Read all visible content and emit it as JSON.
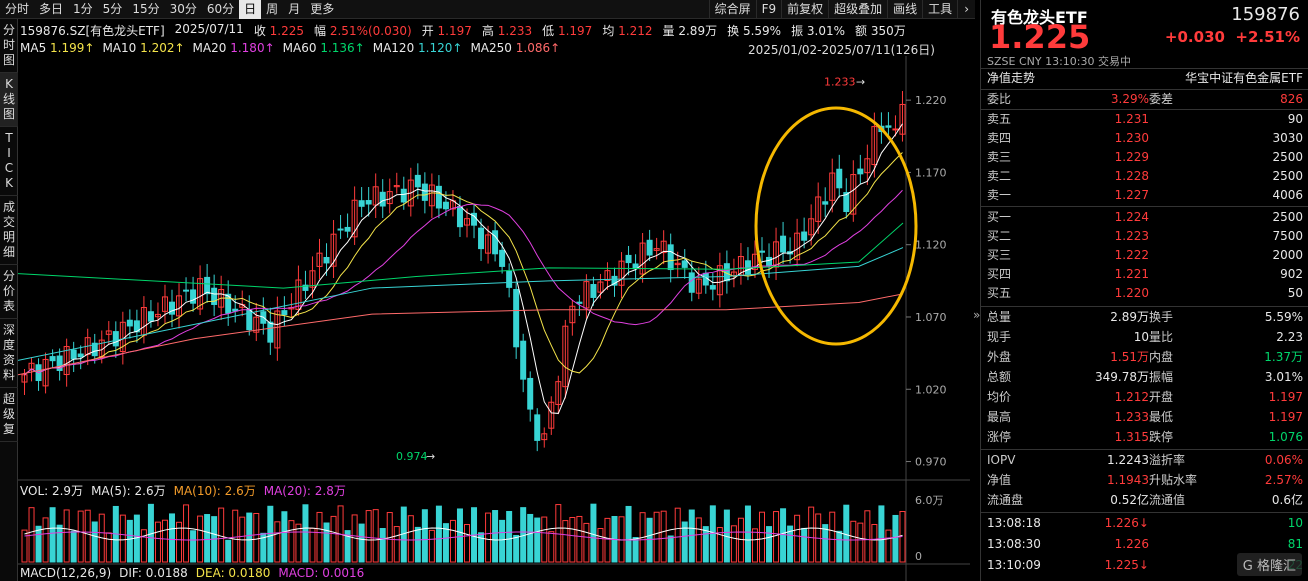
{
  "toolbar": {
    "tabs": [
      "分时",
      "多日",
      "1分",
      "5分",
      "15分",
      "30分",
      "60分",
      "日",
      "周",
      "月",
      "更多"
    ],
    "active": "日",
    "tools": [
      "综合屏",
      "F9",
      "前复权",
      "超级叠加",
      "画线",
      "工具"
    ]
  },
  "leftbar": [
    "分时图",
    "K线图",
    "TICK",
    "成交明细",
    "分价表",
    "深度资料",
    "超级复"
  ],
  "info": {
    "code_name": "159876.SZ[有色龙头ETF]",
    "date": "2025/07/11",
    "close_label": "收",
    "close": "1.225",
    "amp_label": "幅",
    "change": "2.51%(0.030)",
    "open_label": "开",
    "open": "1.197",
    "high_label": "高",
    "high": "1.233",
    "low_label": "低",
    "low": "1.197",
    "avg_label": "均",
    "avg": "1.212",
    "vol_label": "量",
    "vol": "2.89万",
    "turn_label": "换",
    "turn": "5.59%",
    "swing_label": "振",
    "swing": "3.01%",
    "amount_label": "额",
    "amount": "350万"
  },
  "ma": [
    {
      "label": "MA5",
      "value": "1.199↑",
      "color": "#f3e34a"
    },
    {
      "label": "MA10",
      "value": "1.202↑",
      "color": "#f3e34a"
    },
    {
      "label": "MA20",
      "value": "1.180↑",
      "color": "#e040e0"
    },
    {
      "label": "MA60",
      "value": "1.136↑",
      "color": "#00d66b"
    },
    {
      "label": "MA120",
      "value": "1.120↑",
      "color": "#38d4d4"
    },
    {
      "label": "MA250",
      "value": "1.086↑",
      "color": "#ff6a6a"
    }
  ],
  "daterange": "2025/01/02-2025/07/11(126日)",
  "price_axis": [
    "1.220",
    "1.170",
    "1.120",
    "1.070",
    "1.020",
    "0.970"
  ],
  "annotations": {
    "high": "1.233",
    "low": "0.974"
  },
  "vol": {
    "label": "VOL: 2.9万",
    "ma5": "MA(5): 2.6万",
    "ma10": "MA(10): 2.6万",
    "ma20": "MA(20): 2.8万",
    "axis": [
      "6.0万",
      "0"
    ]
  },
  "macd": {
    "label": "MACD(12,26,9)",
    "dif": "DIF: 0.0188",
    "dea": "DEA: 0.0180",
    "macd": "MACD: 0.0016"
  },
  "right": {
    "title": "有色龙头ETF",
    "code": "159876",
    "price": "1.225",
    "change": "+0.030",
    "pct": "+2.51%",
    "sub": "SZSE  CNY  13:10:30  交易中",
    "tabs": {
      "left": "净值走势",
      "right": "华宝中证有色金属ETF"
    },
    "weibi": {
      "l1": "委比",
      "v1": "3.29%",
      "l2": "委差",
      "v2": "826"
    },
    "asks": [
      {
        "l": "卖五",
        "p": "1.231",
        "q": "90"
      },
      {
        "l": "卖四",
        "p": "1.230",
        "q": "3030"
      },
      {
        "l": "卖三",
        "p": "1.229",
        "q": "2500"
      },
      {
        "l": "卖二",
        "p": "1.228",
        "q": "2500"
      },
      {
        "l": "卖一",
        "p": "1.227",
        "q": "4006"
      }
    ],
    "bids": [
      {
        "l": "买一",
        "p": "1.224",
        "q": "2500"
      },
      {
        "l": "买二",
        "p": "1.223",
        "q": "7500"
      },
      {
        "l": "买三",
        "p": "1.222",
        "q": "2000"
      },
      {
        "l": "买四",
        "p": "1.221",
        "q": "902"
      },
      {
        "l": "买五",
        "p": "1.220",
        "q": "50"
      }
    ],
    "stats": [
      {
        "l1": "总量",
        "v1": "2.89万",
        "c1": "white",
        "l2": "换手",
        "v2": "5.59%",
        "c2": "white"
      },
      {
        "l1": "现手",
        "v1": "10",
        "c1": "white",
        "l2": "量比",
        "v2": "2.23",
        "c2": "white"
      },
      {
        "l1": "外盘",
        "v1": "1.51万",
        "c1": "red",
        "l2": "内盘",
        "v2": "1.37万",
        "c2": "green"
      },
      {
        "l1": "总额",
        "v1": "349.78万",
        "c1": "white",
        "l2": "振幅",
        "v2": "3.01%",
        "c2": "white"
      },
      {
        "l1": "均价",
        "v1": "1.212",
        "c1": "red",
        "l2": "开盘",
        "v2": "1.197",
        "c2": "red"
      },
      {
        "l1": "最高",
        "v1": "1.233",
        "c1": "red",
        "l2": "最低",
        "v2": "1.197",
        "c2": "red"
      },
      {
        "l1": "涨停",
        "v1": "1.315",
        "c1": "red",
        "l2": "跌停",
        "v2": "1.076",
        "c2": "green"
      }
    ],
    "iopv": [
      {
        "l1": "IOPV",
        "v1": "1.2243",
        "c1": "white",
        "l2": "溢折率",
        "v2": "0.06%",
        "c2": "red"
      },
      {
        "l1": "净值",
        "v1": "1.1943",
        "c1": "red",
        "l2": "升贴水率",
        "v2": "2.57%",
        "c2": "red"
      },
      {
        "l1": "流通盘",
        "v1": "0.52亿",
        "c1": "white",
        "l2": "流通值",
        "v2": "0.6亿",
        "c2": "white"
      }
    ],
    "ticks": [
      {
        "t": "13:08:18",
        "p": "1.226↓",
        "q": "10",
        "qc": "green"
      },
      {
        "t": "13:08:30",
        "p": "1.226",
        "q": "81",
        "qc": "green"
      },
      {
        "t": "13:10:09",
        "p": "1.225↓",
        "q": "22",
        "qc": "green"
      }
    ],
    "logo": "格隆汇"
  }
}
